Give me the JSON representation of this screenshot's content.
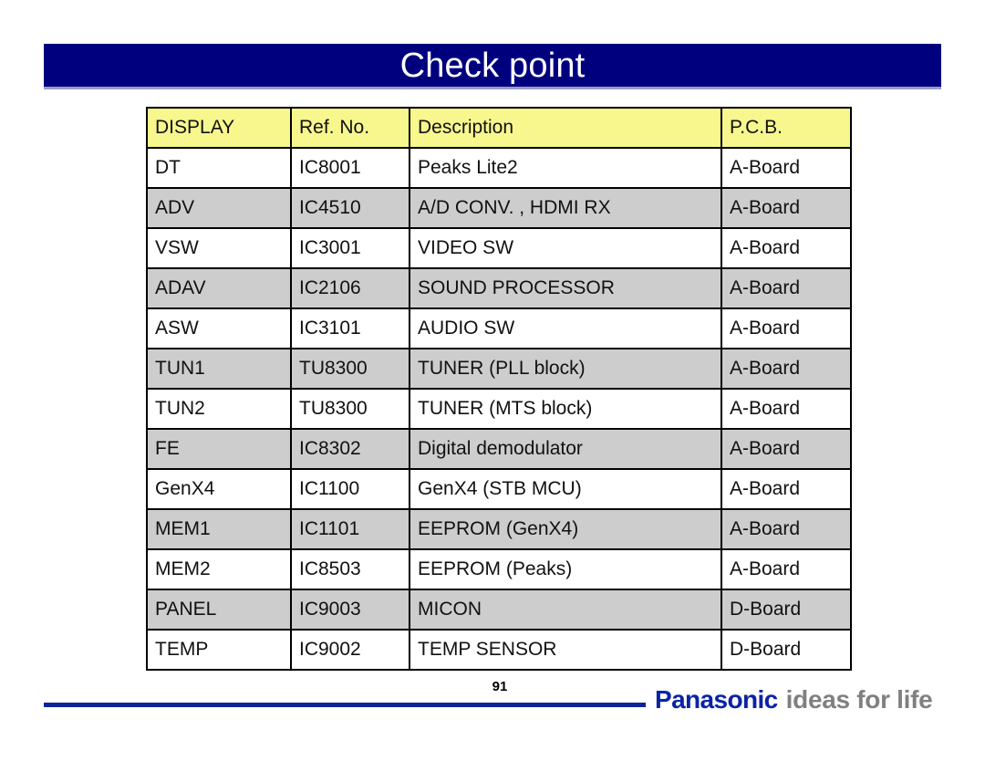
{
  "slide": {
    "title": "Check point",
    "title_bar_color": "#00007E",
    "background_color": "#FFFFFF"
  },
  "table": {
    "header_background": "#F7F78E",
    "alt_row_background": "#CDCDCD",
    "border_color": "#000000",
    "columns": [
      "DISPLAY",
      "Ref. No.",
      "Description",
      "P.C.B."
    ],
    "rows": [
      {
        "display": "DT",
        "ref": "IC8001",
        "description": "Peaks Lite2",
        "pcb": "A-Board",
        "shaded": false
      },
      {
        "display": "ADV",
        "ref": "IC4510",
        "description": "A/D CONV. , HDMI RX",
        "pcb": "A-Board",
        "shaded": true
      },
      {
        "display": "VSW",
        "ref": "IC3001",
        "description": "VIDEO SW",
        "pcb": "A-Board",
        "shaded": false
      },
      {
        "display": "ADAV",
        "ref": "IC2106",
        "description": "SOUND PROCESSOR",
        "pcb": "A-Board",
        "shaded": true
      },
      {
        "display": "ASW",
        "ref": "IC3101",
        "description": "AUDIO SW",
        "pcb": "A-Board",
        "shaded": false
      },
      {
        "display": "TUN1",
        "ref": "TU8300",
        "description": "TUNER (PLL block)",
        "pcb": "A-Board",
        "shaded": true
      },
      {
        "display": "TUN2",
        "ref": "TU8300",
        "description": "TUNER (MTS block)",
        "pcb": "A-Board",
        "shaded": false
      },
      {
        "display": "FE",
        "ref": "IC8302",
        "description": "Digital demodulator",
        "pcb": "A-Board",
        "shaded": true
      },
      {
        "display": "GenX4",
        "ref": "IC1100",
        "description": "GenX4 (STB MCU)",
        "pcb": "A-Board",
        "shaded": false
      },
      {
        "display": "MEM1",
        "ref": "IC1101",
        "description": "EEPROM (GenX4)",
        "pcb": "A-Board",
        "shaded": true
      },
      {
        "display": "MEM2",
        "ref": "IC8503",
        "description": "EEPROM (Peaks)",
        "pcb": "A-Board",
        "shaded": false
      },
      {
        "display": "PANEL",
        "ref": "IC9003",
        "description": "MICON",
        "pcb": "D-Board",
        "shaded": true
      },
      {
        "display": "TEMP",
        "ref": "IC9002",
        "description": "TEMP SENSOR",
        "pcb": "D-Board",
        "shaded": false
      }
    ]
  },
  "footer": {
    "page_number": "91",
    "brand_name": "Panasonic",
    "brand_tagline": "ideas for life",
    "brand_color": "#0B23A5",
    "tagline_color": "#808080",
    "rule_color": "#0B239B"
  }
}
